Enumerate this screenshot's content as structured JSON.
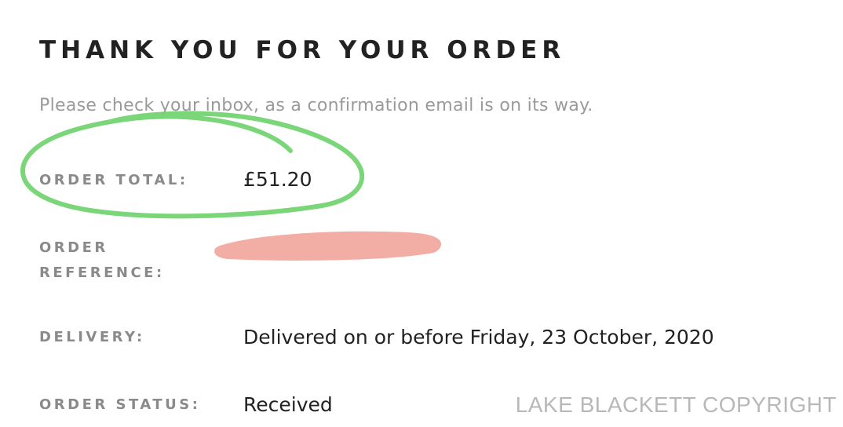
{
  "heading": "THANK YOU FOR YOUR ORDER",
  "subtext": "Please check your inbox, as a confirmation email is on its way.",
  "order_total": {
    "label": "ORDER TOTAL:",
    "value": "£51.20"
  },
  "order_reference": {
    "label": "ORDER REFERENCE:"
  },
  "delivery": {
    "label": "DELIVERY:",
    "value": "Delivered on or before Friday, 23 October, 2020"
  },
  "order_status": {
    "label": "ORDER STATUS:",
    "value": "Received"
  },
  "watermark": "LAKE BLACKETT COPYRIGHT",
  "colors": {
    "circle_annotation": "#6dd06a",
    "redaction_mark": "#f2aaa0"
  }
}
